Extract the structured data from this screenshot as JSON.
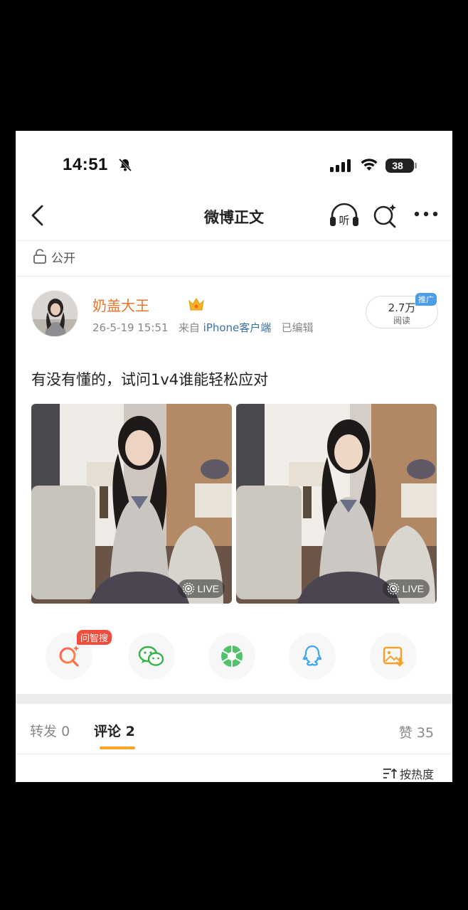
{
  "status_bar": {
    "time": "14:51",
    "battery": "38"
  },
  "nav": {
    "title": "微博正文",
    "listen_label": "听"
  },
  "visibility": {
    "label": "公开"
  },
  "author": {
    "name": "奶盖大王",
    "date": "26-5-19 15:51",
    "from_prefix": "来自",
    "source": "iPhone客户端",
    "edited": "已编辑"
  },
  "reads": {
    "count": "2.7万",
    "label": "阅读",
    "promo_badge": "推广"
  },
  "post": {
    "text": "有没有懂的，试问1v4谁能轻松应对"
  },
  "photos": [
    {
      "live_label": "LIVE"
    },
    {
      "live_label": "LIVE"
    }
  ],
  "share_row": {
    "badge": "问智搜",
    "items": [
      "smart-search-icon",
      "wechat-icon",
      "moments-icon",
      "qq-icon",
      "save-image-icon"
    ]
  },
  "tabs": [
    {
      "label": "转发",
      "count": "0"
    },
    {
      "label": "评论",
      "count": "2"
    }
  ],
  "likes": {
    "label": "赞",
    "count": "35"
  },
  "sort": {
    "label": "按热度"
  },
  "colors": {
    "accent": "#f5a623",
    "author": "#e8752a",
    "link": "#3b6ea6",
    "badge": "#f24c3d",
    "promo": "#4b9de6"
  }
}
